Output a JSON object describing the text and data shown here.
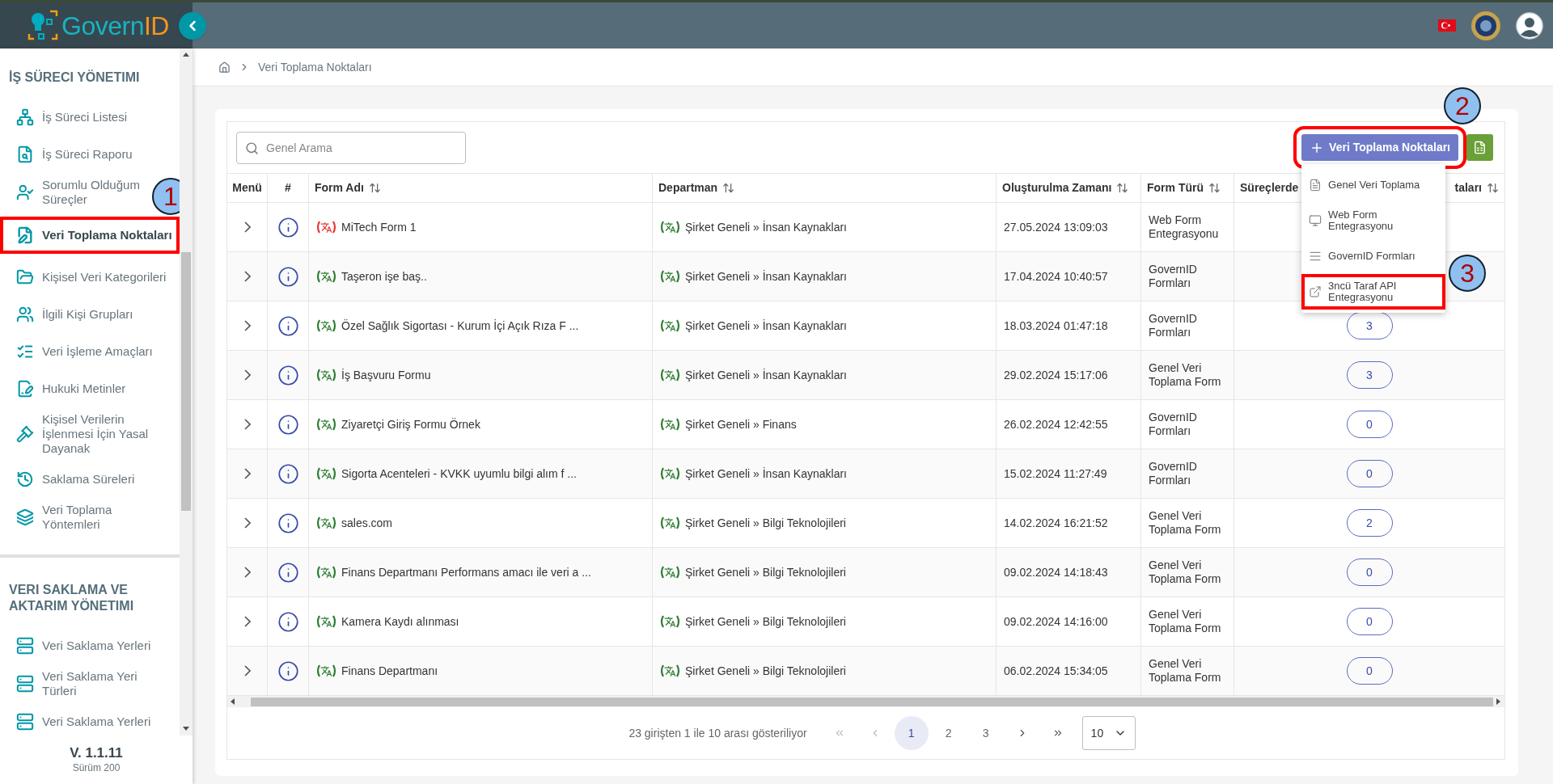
{
  "header": {
    "logo": {
      "prefix": "Govern",
      "suffix": "ID"
    }
  },
  "sidebar": {
    "sections": [
      {
        "title": "İŞ SÜRECI YÖNETIMI",
        "items": [
          {
            "label": "İş Süreci Listesi",
            "selected": false
          },
          {
            "label": "İş Süreci Raporu",
            "selected": false
          },
          {
            "label": "Sorumlu Olduğum Süreçler",
            "selected": false
          },
          {
            "label": "Veri Toplama Noktaları",
            "selected": true,
            "callout": "1"
          },
          {
            "label": "Kişisel Veri Kategorileri",
            "selected": false
          },
          {
            "label": "İlgili Kişi Grupları",
            "selected": false
          },
          {
            "label": "Veri İşleme Amaçları",
            "selected": false
          },
          {
            "label": "Hukuki Metinler",
            "selected": false
          },
          {
            "label": "Kişisel Verilerin İşlenmesi İçin Yasal Dayanak",
            "selected": false
          },
          {
            "label": "Saklama Süreleri",
            "selected": false
          },
          {
            "label": "Veri Toplama Yöntemleri",
            "selected": false
          }
        ]
      },
      {
        "title": "VERI SAKLAMA VE AKTARIM YÖNETIMI",
        "items": [
          {
            "label": "Veri Saklama Yerleri",
            "selected": false
          },
          {
            "label": "Veri Saklama Yeri Türleri",
            "selected": false
          },
          {
            "label": "Veri Saklama Yerleri",
            "selected": false
          }
        ]
      }
    ],
    "version": "V. 1.1.11",
    "build": "Sürüm 200"
  },
  "breadcrumb": [
    "Veri Toplama Noktaları"
  ],
  "toolbar": {
    "search": {
      "placeholder": "Genel Arama"
    },
    "add_button": {
      "label": "Veri Toplama Noktaları",
      "callout": "2"
    },
    "menu": [
      {
        "label": "Genel Veri Toplama"
      },
      {
        "label": "Web Form Entegrasyonu"
      },
      {
        "label": "GovernID Formları"
      },
      {
        "label": "3ncü Taraf API Entegrasyonu",
        "callout": "3"
      }
    ]
  },
  "table": {
    "columns": [
      {
        "label": "Menü",
        "sortable": false
      },
      {
        "label": "#",
        "sortable": false
      },
      {
        "label": "Form Adı",
        "sortable": true
      },
      {
        "label": "Departman",
        "sortable": true
      },
      {
        "label": "Oluşturulma Zamanı",
        "sortable": true
      },
      {
        "label": "Form Türü",
        "sortable": true
      },
      {
        "label": "Süreçlerde",
        "tail": "taları",
        "sortable": true
      }
    ],
    "rows": [
      {
        "form_name": "MiTech Form 1",
        "color": "#e53935",
        "department": "Şirket Geneli » İnsan Kaynakları",
        "created": "27.05.2024 13:09:03",
        "form_type": "Web Form Entegrasyonu"
      },
      {
        "form_name": "Taşeron işe baş..",
        "color": "#2e7d32",
        "department": "Şirket Geneli » İnsan Kaynakları",
        "created": "17.04.2024 10:40:57",
        "form_type": "GovernID Formları"
      },
      {
        "form_name": "Özel Sağlık Sigortası - Kurum İçi Açık Rıza F ...",
        "color": "#2e7d32",
        "department": "Şirket Geneli » İnsan Kaynakları",
        "created": "18.03.2024 01:47:18",
        "form_type": "GovernID Formları",
        "count": "3"
      },
      {
        "form_name": "İş Başvuru Formu",
        "color": "#2e7d32",
        "department": "Şirket Geneli » İnsan Kaynakları",
        "created": "29.02.2024 15:17:06",
        "form_type": "Genel Veri Toplama Form",
        "count": "3"
      },
      {
        "form_name": "Ziyaretçi Giriş Formu Örnek",
        "color": "#2e7d32",
        "department": "Şirket Geneli » Finans",
        "created": "26.02.2024 12:42:55",
        "form_type": "GovernID Formları",
        "count": "0"
      },
      {
        "form_name": "Sigorta Acenteleri - KVKK uyumlu bilgi alım f ...",
        "color": "#2e7d32",
        "department": "Şirket Geneli » İnsan Kaynakları",
        "created": "15.02.2024 11:27:49",
        "form_type": "GovernID Formları",
        "count": "0"
      },
      {
        "form_name": "sales.com",
        "color": "#2e7d32",
        "department": "Şirket Geneli » Bilgi Teknolojileri",
        "created": "14.02.2024 16:21:52",
        "form_type": "Genel Veri Toplama Form",
        "count": "2"
      },
      {
        "form_name": "Finans Departmanı Performans amacı ile veri a ...",
        "color": "#2e7d32",
        "department": "Şirket Geneli » Bilgi Teknolojileri",
        "created": "09.02.2024 14:18:43",
        "form_type": "Genel Veri Toplama Form",
        "count": "0"
      },
      {
        "form_name": "Kamera Kaydı alınması",
        "color": "#2e7d32",
        "department": "Şirket Geneli » Bilgi Teknolojileri",
        "created": "09.02.2024 14:16:00",
        "form_type": "Genel Veri Toplama Form",
        "count": "0"
      },
      {
        "form_name": "Finans Departmanı",
        "color": "#2e7d32",
        "department": "Şirket Geneli » Bilgi Teknolojileri",
        "created": "06.02.2024 15:34:05",
        "form_type": "Genel Veri Toplama Form",
        "count": "0"
      }
    ]
  },
  "pagination": {
    "summary": "23 girişten 1 ile 10 arası gösteriliyor",
    "pages": [
      {
        "label": "1",
        "selected": true
      },
      {
        "label": "2",
        "selected": false
      },
      {
        "label": "3",
        "selected": false
      }
    ],
    "page_size": "10"
  }
}
